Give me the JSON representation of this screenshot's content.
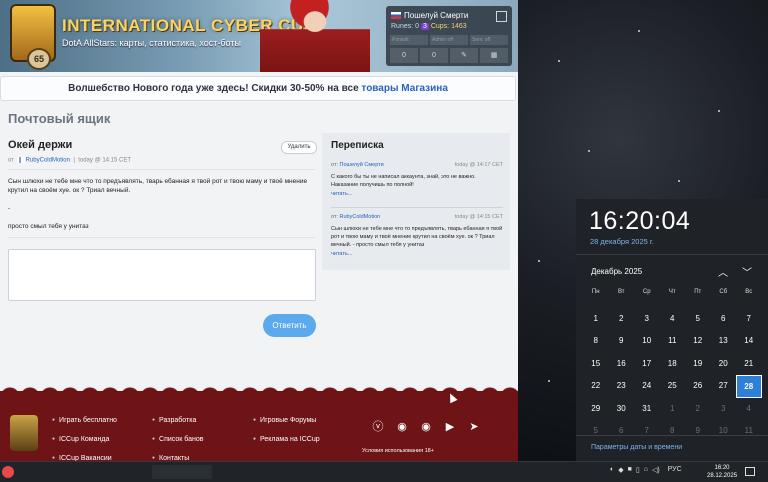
{
  "site": {
    "banner_title": "INTERNATIONAL CYBER CUP",
    "banner_subtitle": "DotA AllStars: карты, статистика, хост-боты",
    "level_badge": "65",
    "user": {
      "name": "Пошелуй Смерти",
      "runes_label": "Runes: 0",
      "runes_badge": "3",
      "cups_label": "Cups: 1463",
      "row2": [
        "Ponsalt",
        "Admin off",
        "Serv. off"
      ],
      "row3": [
        "0",
        "0",
        "",
        ""
      ]
    },
    "promo": {
      "text": "Волшебство Нового года уже здесь! Скидки 30-50% на все",
      "link": "товары Магазина"
    }
  },
  "mailbox": {
    "page_title": "Почтовый ящик",
    "message": {
      "title": "Окей держи",
      "delete_label": "Удалить",
      "from_prefix": "от",
      "author": "RubyColdMotion",
      "date": "today @ 14:15 CET",
      "paragraphs": [
        "Сын шлюхи не тебе мне что то предъявлять, тварь ебанная я твой рот и твою маму и твоё мнение крутил на своём хуе. ок ? Триал вечный.",
        "-",
        "просто смыл тебя у унитаз"
      ]
    },
    "reply_placeholder": "",
    "send_label": "Ответить"
  },
  "correspondence": {
    "title": "Переписка",
    "items": [
      {
        "from_prefix": "от:",
        "author": "Пошелуй Смерти",
        "date": "today @ 14:17 CET",
        "text": "С какого бы ты не написал аккаунта, знай, это не важно. Наказание получишь по полной!",
        "more": "читать..."
      },
      {
        "from_prefix": "от:",
        "author": "RubyColdMotion",
        "date": "today @ 14:15 CET",
        "text": "Сын шлюхи не тебе мне что то предъявлять, тварь ебанная я твой рот и твою маму и твоё мнение крутил на своём хуе. ок ? Триал вечный. - просто смыл тебя у унитаз",
        "more": "читать..."
      }
    ]
  },
  "footer": {
    "col1": [
      "Играть бесплатно",
      "ICCup Команда",
      "ICCup Вакансии"
    ],
    "col2": [
      "Разработка",
      "Список банов",
      "Контакты"
    ],
    "col3": [
      "Игровые Форумы",
      "Реклама на ICCup"
    ],
    "social": [
      "VK",
      "Discord",
      "Discord",
      "YouTube",
      "Telegram"
    ],
    "age_notice": "Условия использования 18+"
  },
  "calendar": {
    "time": "16:20:04",
    "date_long": "28 декабря 2025 г.",
    "month": "Декабрь 2025",
    "weekdays": [
      "Пн",
      "Вт",
      "Ср",
      "Чт",
      "Пт",
      "Сб",
      "Вс"
    ],
    "weeks": [
      [
        "1",
        "2",
        "3",
        "4",
        "5",
        "6",
        "7"
      ],
      [
        "8",
        "9",
        "10",
        "11",
        "12",
        "13",
        "14"
      ],
      [
        "15",
        "16",
        "17",
        "18",
        "19",
        "20",
        "21"
      ],
      [
        "22",
        "23",
        "24",
        "25",
        "26",
        "27",
        "28"
      ],
      [
        "29",
        "30",
        "31",
        "1",
        "2",
        "3",
        "4"
      ],
      [
        "5",
        "6",
        "7",
        "8",
        "9",
        "10",
        "11"
      ]
    ],
    "today": "28",
    "settings_link": "Параметры даты и времени"
  },
  "taskbar": {
    "language": "РУС",
    "time": "16:20",
    "date": "28.12.2025"
  },
  "colors": {
    "accent": "#2d7fd7",
    "link": "#2a63b8",
    "send_button": "#5da9ee",
    "footer": "#6e1316"
  }
}
